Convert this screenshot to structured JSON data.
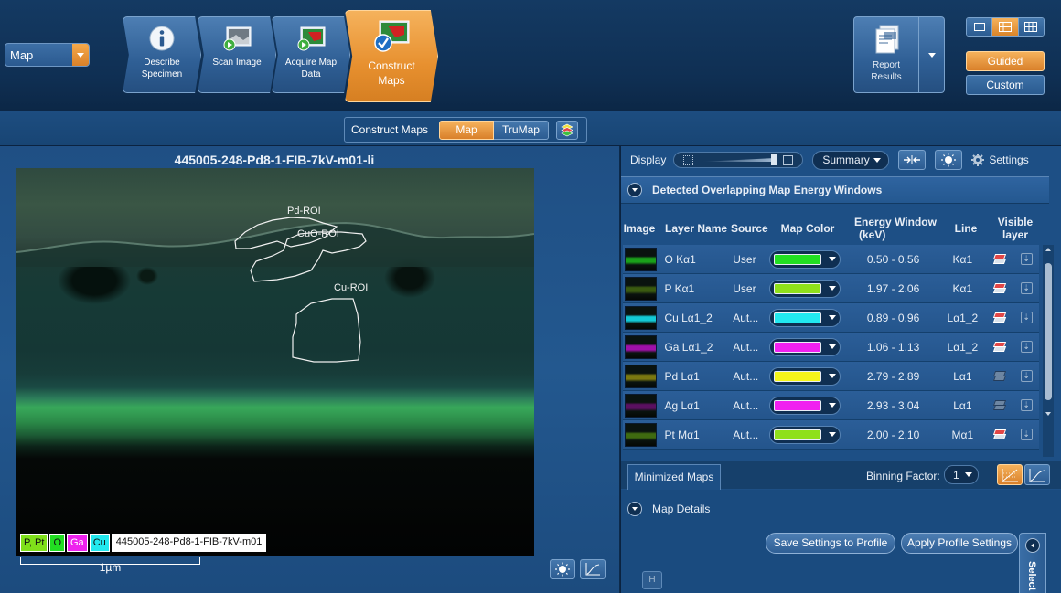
{
  "toolbar": {
    "mode": "Map",
    "steps": [
      {
        "label_1": "Describe",
        "label_2": "Specimen",
        "icon": "info-icon"
      },
      {
        "label_1": "Scan Image",
        "label_2": "",
        "icon": "scan-image-icon"
      },
      {
        "label_1": "Acquire Map",
        "label_2": "Data",
        "icon": "acquire-map-icon"
      },
      {
        "label_1": "Construct",
        "label_2": "Maps",
        "icon": "construct-maps-icon",
        "active": true
      }
    ],
    "report": {
      "label_1": "Report",
      "label_2": "Results",
      "icon": "report-icon"
    },
    "guided_label": "Guided",
    "custom_label": "Custom",
    "guided_active": true
  },
  "subbar": {
    "title": "Construct Maps",
    "map_label": "Map",
    "trumap_label": "TruMap",
    "active": "Map"
  },
  "image_panel": {
    "title": "445005-248-Pd8-1-FIB-7kV-m01-li",
    "rois": [
      "Pd-ROI",
      "CuO-ROI",
      "Cu-ROI"
    ],
    "legend": [
      {
        "label": "P, Pt",
        "color": "#7fe01a"
      },
      {
        "label": "O",
        "color": "#22dd22"
      },
      {
        "label": "Ga",
        "color": "#ee22ee"
      },
      {
        "label": "Cu",
        "color": "#22e8ee"
      }
    ],
    "legend_name": "445005-248-Pd8-1-FIB-7kV-m01",
    "scale_label": "1µm"
  },
  "right_panel": {
    "display_label": "Display",
    "summary_value": "Summary",
    "settings_label": "Settings",
    "overlap_header": "Detected Overlapping Map Energy Windows",
    "columns": {
      "image": "Image",
      "layer_name": "Layer Name",
      "source": "Source",
      "map_color": "Map Color",
      "energy_1": "Energy Window",
      "energy_2": "(keV)",
      "line": "Line",
      "visible_1": "Visible",
      "visible_2": "layer"
    },
    "layers": [
      {
        "name": "O Kα1",
        "source": "User",
        "color": "#22e022",
        "thumb": "#1aa01a",
        "energy": "0.50 - 0.56",
        "line": "Kα1",
        "visible": true
      },
      {
        "name": "P Kα1",
        "source": "User",
        "color": "#8fe01a",
        "thumb": "#3a5a10",
        "energy": "1.97 - 2.06",
        "line": "Kα1",
        "visible": true
      },
      {
        "name": "Cu Lα1_2",
        "source": "Aut...",
        "color": "#22e8f0",
        "thumb": "#13c9d6",
        "energy": "0.89 - 0.96",
        "line": "Lα1_2",
        "visible": true
      },
      {
        "name": "Ga Lα1_2",
        "source": "Aut...",
        "color": "#f020f0",
        "thumb": "#a010a8",
        "energy": "1.06 - 1.13",
        "line": "Lα1_2",
        "visible": true
      },
      {
        "name": "Pd Lα1",
        "source": "Aut...",
        "color": "#f4f41a",
        "thumb": "#7a7810",
        "energy": "2.79 - 2.89",
        "line": "Lα1",
        "visible": false
      },
      {
        "name": "Ag Lα1",
        "source": "Aut...",
        "color": "#f020f0",
        "thumb": "#5a1060",
        "energy": "2.93 - 3.04",
        "line": "Lα1",
        "visible": false
      },
      {
        "name": "Pt Mα1",
        "source": "Aut...",
        "color": "#8fe01a",
        "thumb": "#3f6a10",
        "energy": "2.00 - 2.10",
        "line": "Mα1",
        "visible": true
      }
    ],
    "minimized_tab": "Minimized Maps",
    "binning_label": "Binning Factor:",
    "binning_value": "1",
    "details_header": "Map Details",
    "save_profile": "Save Settings to Profile",
    "apply_profile": "Apply Profile Settings",
    "h_button": "H",
    "side_label": "Select"
  }
}
